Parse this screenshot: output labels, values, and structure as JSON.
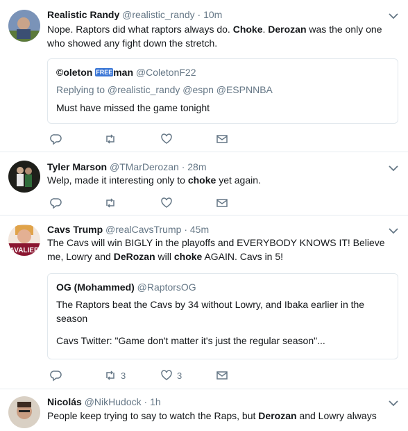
{
  "tweets": [
    {
      "name": "Realistic Randy",
      "handle": "@realistic_randy",
      "time": "10m",
      "text_parts": [
        "Nope. Raptors did what raptors always do. ",
        "Choke",
        ". ",
        "Derozan",
        " was the only one who showed any fight down the stretch."
      ],
      "quote": {
        "name_prefix": "©oleton ",
        "name_badge": "FREE",
        "name_suffix": "man",
        "handle": "@ColetonF22",
        "reply": "Replying to @realistic_randy @espn @ESPNNBA",
        "text": "Must have missed the game tonight"
      }
    },
    {
      "name": "Tyler Marson",
      "handle": "@TMarDerozan",
      "time": "28m",
      "text_parts": [
        "Welp, made it interesting only to ",
        "choke",
        " yet again."
      ]
    },
    {
      "name": "Cavs Trump",
      "handle": "@realCavsTrump",
      "time": "45m",
      "text_parts": [
        "The Cavs will win BIGLY in the playoffs and EVERYBODY KNOWS IT! Believe me, Lowry and ",
        "DeRozan",
        " will ",
        "choke",
        " AGAIN. Cavs in 5!"
      ],
      "avatar_text": "AVALIER",
      "quote": {
        "name": "OG (Mohammed)",
        "handle": "@RaptorsOG",
        "text1": "The Raptors beat the Cavs by 34 without Lowry, and Ibaka earlier in the season",
        "text2": "Cavs Twitter: \"Game don't matter it's just the regular season\"..."
      },
      "retweets": "3",
      "likes": "3"
    },
    {
      "name": "Nicolás",
      "handle": "@NikHudock",
      "time": "1h",
      "text_parts": [
        "People keep trying to say to watch the Raps, but ",
        "Derozan",
        " and Lowry always"
      ]
    }
  ],
  "dot": "·",
  "icons": [
    "reply-icon",
    "retweet-icon",
    "like-icon",
    "message-icon",
    "chevron-down-icon"
  ],
  "colors": {
    "meta": "#657786",
    "border": "#e6ecf0",
    "icon": "#657786"
  }
}
